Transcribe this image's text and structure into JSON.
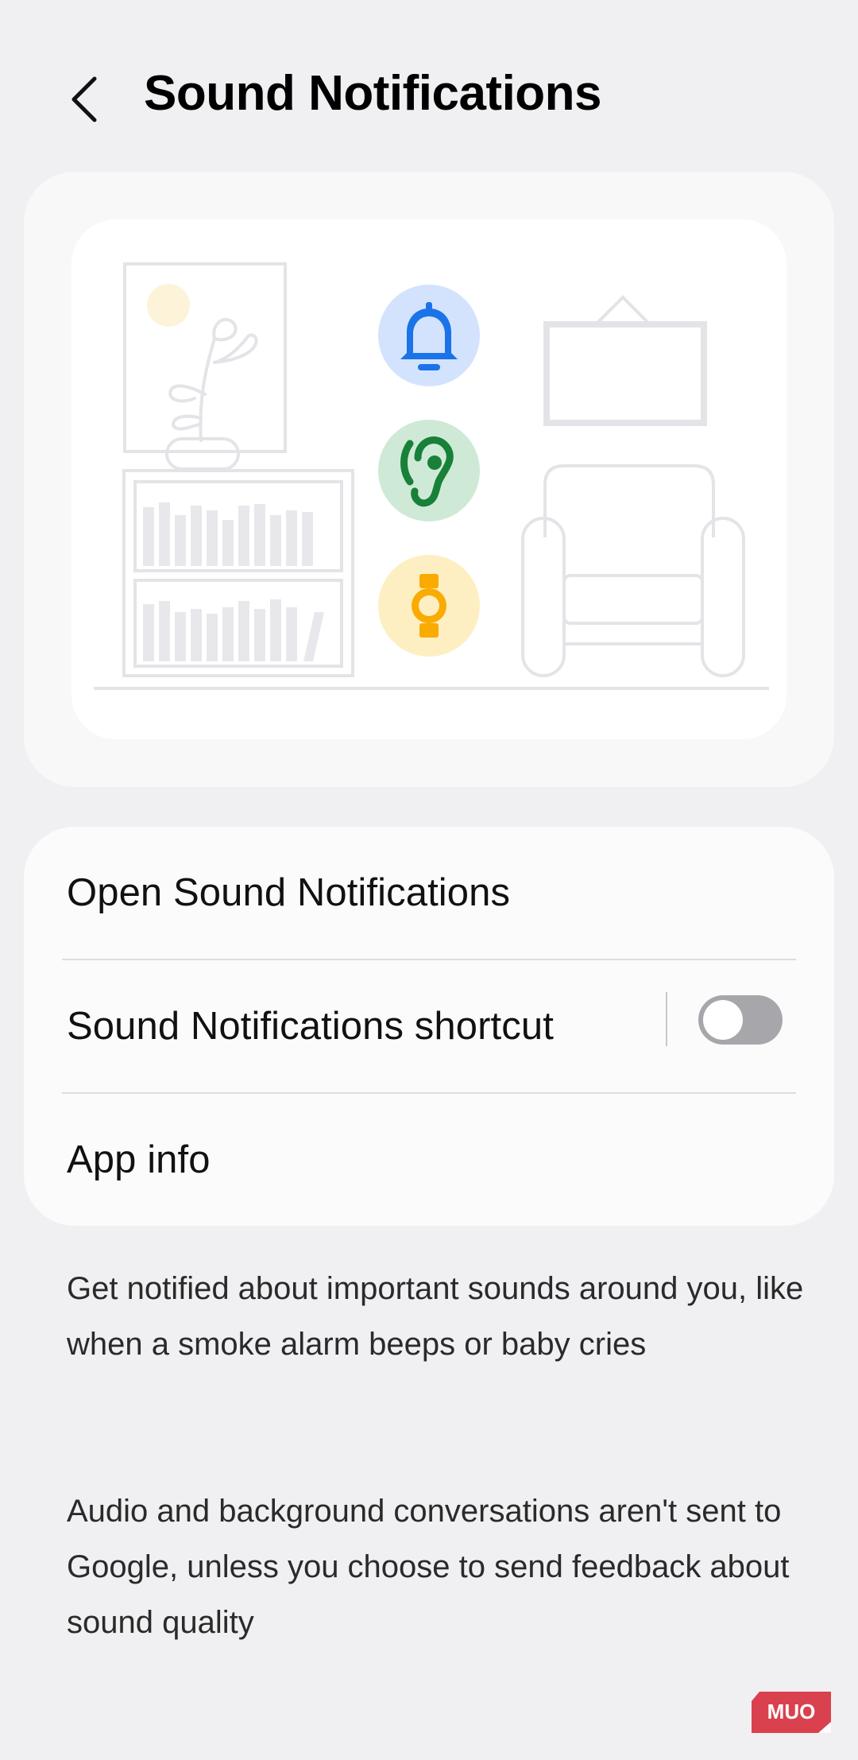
{
  "header": {
    "title": "Sound Notifications"
  },
  "settings": {
    "open_label": "Open Sound Notifications",
    "shortcut_label": "Sound Notifications shortcut",
    "shortcut_enabled": false,
    "app_info_label": "App info"
  },
  "description": {
    "paragraph_1": "Get notified about important sounds around you, like when a smoke alarm beeps or baby cries",
    "paragraph_2": "Audio and background conversations aren't sent to Google, unless you choose to send feedback about sound quality"
  },
  "illustration": {
    "icons": [
      "bell-icon",
      "ear-icon",
      "watch-icon"
    ],
    "colors": {
      "bell_bg": "#d3e3fd",
      "bell_fg": "#1a73e8",
      "ear_bg": "#ceead6",
      "ear_fg": "#188038",
      "watch_bg": "#feefc3",
      "watch_fg": "#f9ab00"
    }
  },
  "watermark": {
    "text": "MUO"
  }
}
